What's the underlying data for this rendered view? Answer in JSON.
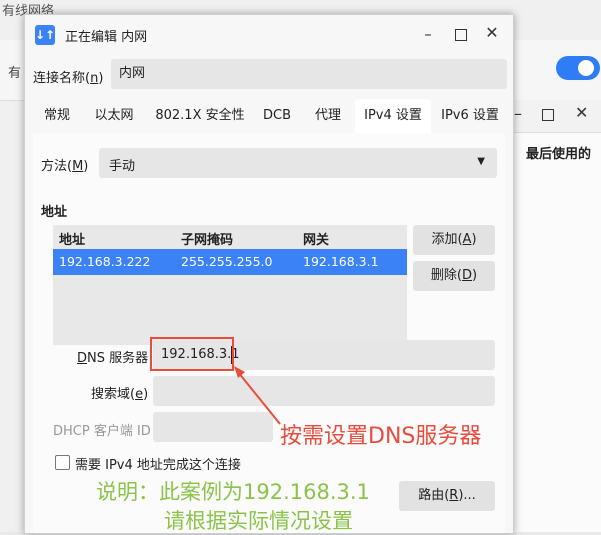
{
  "background": {
    "title_fragment": "有线网络",
    "left_char": "有",
    "column_header": "最后使用的"
  },
  "dialog": {
    "app_icon": "↓↑",
    "title": "正在编辑 内网",
    "connection_name": {
      "label": "连接名称(n)",
      "value": "内网"
    },
    "tabs": [
      "常规",
      "以太网",
      "802.1X 安全性",
      "DCB",
      "代理",
      "IPv4 设置",
      "IPv6 设置"
    ],
    "active_tab": "IPv4 设置",
    "method": {
      "label": "方法(M)",
      "value": "手动"
    },
    "address_section": {
      "title": "地址",
      "columns": [
        "地址",
        "子网掩码",
        "网关"
      ],
      "rows": [
        {
          "address": "192.168.3.222",
          "netmask": "255.255.255.0",
          "gateway": "192.168.3.1"
        }
      ],
      "add_button": "添加(A)",
      "delete_button": "删除(D)"
    },
    "dns": {
      "label": "DNS 服务器",
      "value": "192.168.3.1"
    },
    "search_domain": {
      "label": "搜索域(e)",
      "value": ""
    },
    "dhcp_client_id": {
      "label": "DHCP 客户端 ID",
      "value": ""
    },
    "require_ipv4": {
      "label": "需要 IPv4 地址完成这个连接",
      "checked": false
    },
    "routes_button": "路由(R)..."
  },
  "annotations": {
    "red_note": "按需设置DNS服务器",
    "green_line1": "说明：此案例为192.168.3.1",
    "green_line2": "请根据实际情况设置",
    "red_color": "#e74c3c",
    "green_color": "#8bc34a"
  },
  "colors": {
    "accent": "#3b82f6"
  }
}
